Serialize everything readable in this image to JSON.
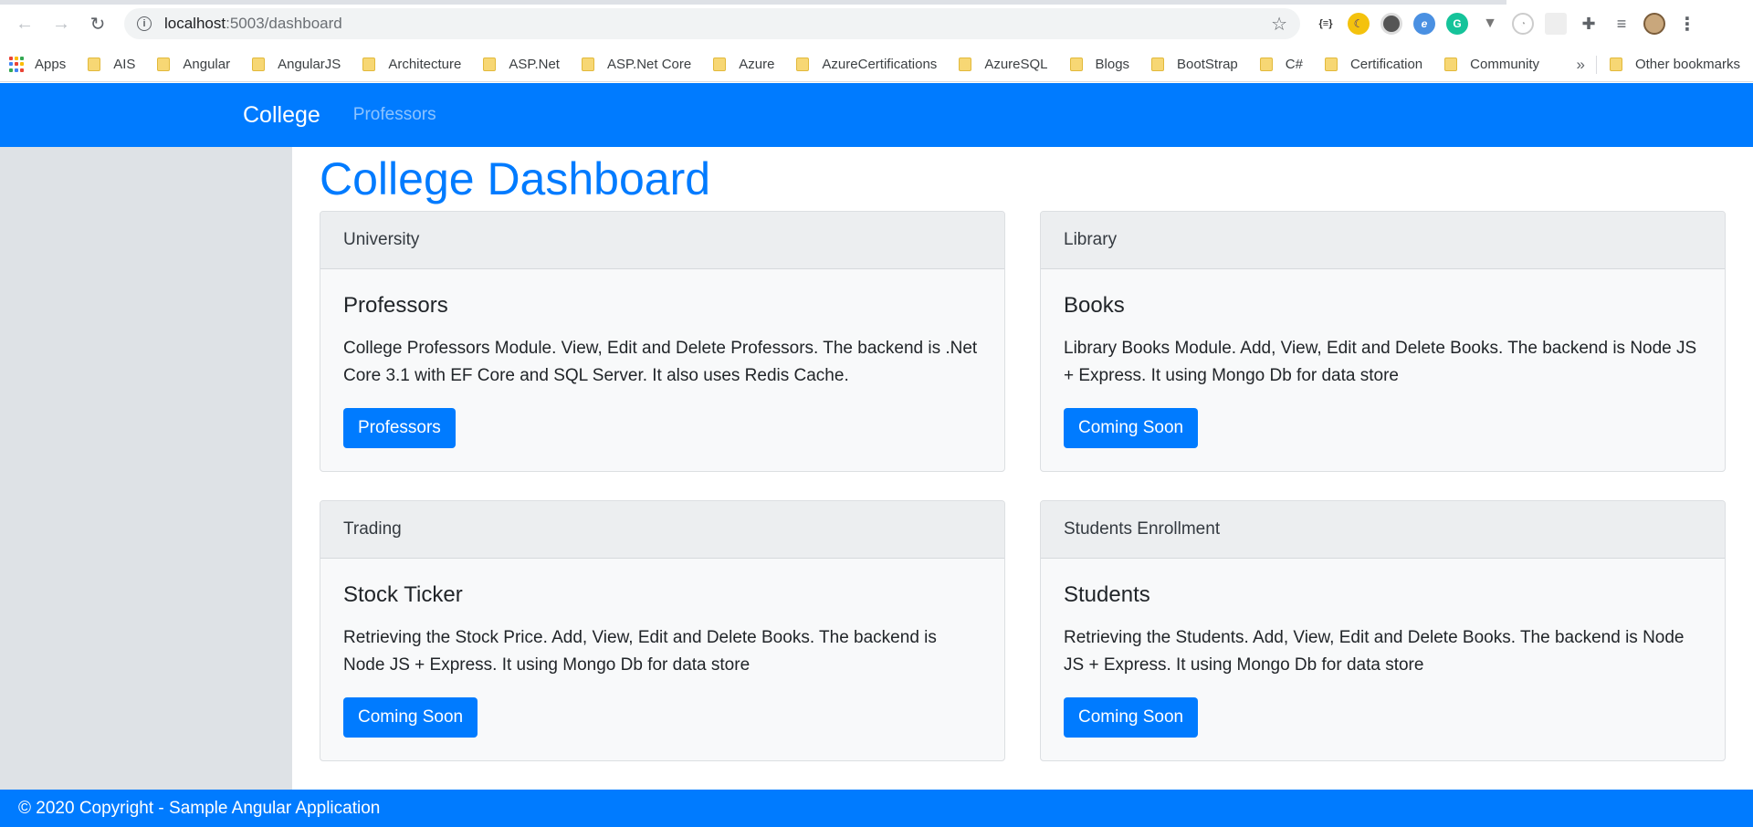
{
  "browser": {
    "url_host": "localhost",
    "url_path": ":5003/dashboard",
    "extensions": [
      "json-viewer-icon",
      "night-mode-icon",
      "circle-ext-icon",
      "edge-ext-icon",
      "grammarly-icon",
      "vue-devtools-icon",
      "timer-ext-icon",
      "page-ext-icon",
      "puzzle-icon",
      "playlist-icon"
    ],
    "apps_label": "Apps",
    "bookmarks": [
      "AIS",
      "Angular",
      "AngularJS",
      "Architecture",
      "ASP.Net",
      "ASP.Net Core",
      "Azure",
      "AzureCertifications",
      "AzureSQL",
      "Blogs",
      "BootStrap",
      "C#",
      "Certification",
      "Community"
    ],
    "more_label": "»",
    "other_bookmarks": "Other bookmarks"
  },
  "navbar": {
    "brand": "College",
    "links": [
      "Professors"
    ]
  },
  "main": {
    "title": "College Dashboard",
    "cards": [
      {
        "header": "University",
        "title": "Professors",
        "text": "College Professors Module. View, Edit and Delete Professors. The backend is .Net Core 3.1 with EF Core and SQL Server. It also uses Redis Cache.",
        "button": "Professors"
      },
      {
        "header": "Library",
        "title": "Books",
        "text": "Library Books Module. Add, View, Edit and Delete Books. The backend is Node JS + Express. It using Mongo Db for data store",
        "button": "Coming Soon"
      },
      {
        "header": "Trading",
        "title": "Stock Ticker",
        "text": "Retrieving the Stock Price. Add, View, Edit and Delete Books. The backend is Node JS + Express. It using Mongo Db for data store",
        "button": "Coming Soon"
      },
      {
        "header": "Students Enrollment",
        "title": "Students",
        "text": "Retrieving the Students. Add, View, Edit and Delete Books. The backend is Node JS + Express. It using Mongo Db for data store",
        "button": "Coming Soon"
      }
    ]
  },
  "footer": {
    "text": "© 2020 Copyright - Sample Angular Application"
  },
  "colors": {
    "primary": "#007bff",
    "sidebar": "#dee2e6",
    "card_bg": "#f8f9fa"
  }
}
